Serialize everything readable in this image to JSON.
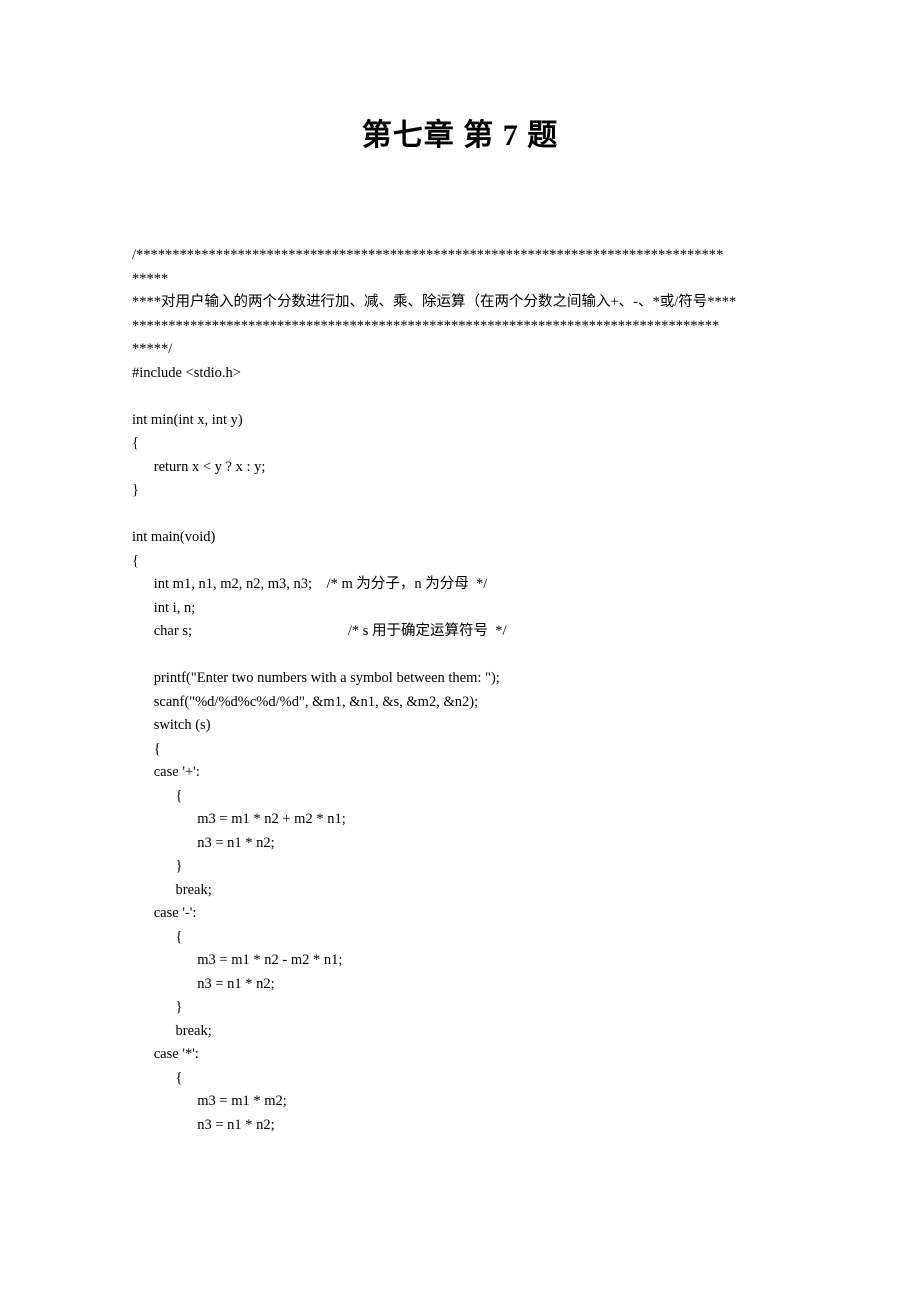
{
  "title": "第七章 第 7 题",
  "code_lines": [
    "/*********************************************************************************",
    "*****",
    "****对用户输入的两个分数进行加、减、乘、除运算（在两个分数之间输入+、-、*或/符号****",
    "*********************************************************************************",
    "*****/",
    "#include <stdio.h>",
    "",
    "int min(int x, int y)",
    "{",
    "      return x < y ? x : y;",
    "}",
    "",
    "int main(void)",
    "{",
    "      int m1, n1, m2, n2, m3, n3;    /* m 为分子，n 为分母  */",
    "      int i, n;",
    "      char s;                                           /* s 用于确定运算符号  */",
    "",
    "      printf(\"Enter two numbers with a symbol between them: \");",
    "      scanf(\"%d/%d%c%d/%d\", &m1, &n1, &s, &m2, &n2);",
    "      switch (s)",
    "      {",
    "      case '+':",
    "            {",
    "                  m3 = m1 * n2 + m2 * n1;",
    "                  n3 = n1 * n2;",
    "            }",
    "            break;",
    "      case '-':",
    "            {",
    "                  m3 = m1 * n2 - m2 * n1;",
    "                  n3 = n1 * n2;",
    "            }",
    "            break;",
    "      case '*':",
    "            {",
    "                  m3 = m1 * m2;",
    "                  n3 = n1 * n2;"
  ]
}
